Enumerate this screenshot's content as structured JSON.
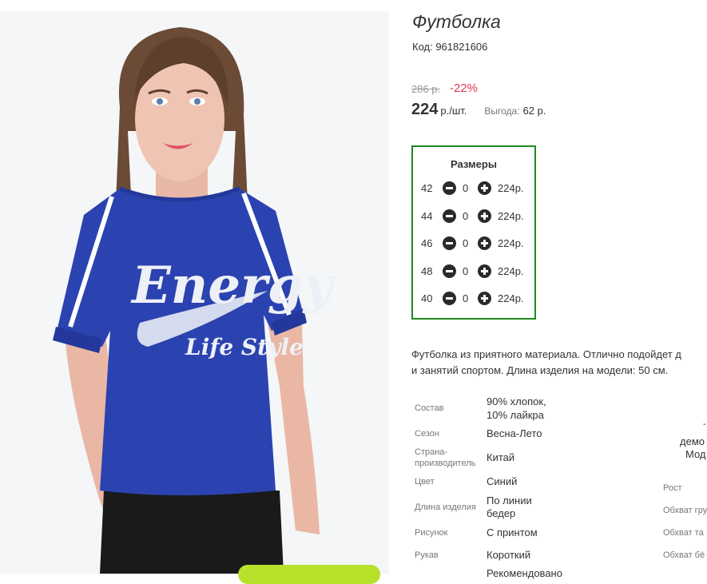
{
  "product": {
    "title": "Футболка",
    "code": "Код: 961821606",
    "old_price": "286 р.",
    "discount": "-22%",
    "price": "224",
    "unit": "р./шт.",
    "saving_label": "Выгода:",
    "saving_value": "62 р."
  },
  "sizes": {
    "title": "Размеры",
    "rows": [
      {
        "size": "42",
        "qty": "0",
        "price": "224р."
      },
      {
        "size": "44",
        "qty": "0",
        "price": "224р."
      },
      {
        "size": "46",
        "qty": "0",
        "price": "224р."
      },
      {
        "size": "48",
        "qty": "0",
        "price": "224р."
      },
      {
        "size": "40",
        "qty": "0",
        "price": "224р."
      }
    ]
  },
  "description": {
    "line1": "Футболка из приятного материала. Отлично подойдет д",
    "line2": "и занятий спортом. Длина изделия на модели: 50 см."
  },
  "properties": {
    "composition": {
      "label": "Состав",
      "value1": "90% хлопок,",
      "value2": "10% лайкра"
    },
    "season": {
      "label": "Сезон",
      "value": "Весна-Лето"
    },
    "country": {
      "label1": "Страна-",
      "label2": "производитель",
      "value": "Китай"
    },
    "color": {
      "label": "Цвет",
      "value": "Синий"
    },
    "length": {
      "label": "Длина изделия",
      "value1": "По линии",
      "value2": "бедер"
    },
    "pattern": {
      "label": "Рисунок",
      "value": "С принтом"
    },
    "sleeve": {
      "label": "Рукав",
      "value": "Короткий"
    },
    "more": {
      "value": "Рекомендовано"
    }
  },
  "model_params": {
    "dash": "-",
    "demo": "демо",
    "model": "Мод",
    "height": "Рост",
    "chest": "Обхват гру",
    "waist": "Обхват та",
    "hips": "Обхват бё"
  },
  "print": {
    "line1": "Energy",
    "line2": "Life Style"
  }
}
